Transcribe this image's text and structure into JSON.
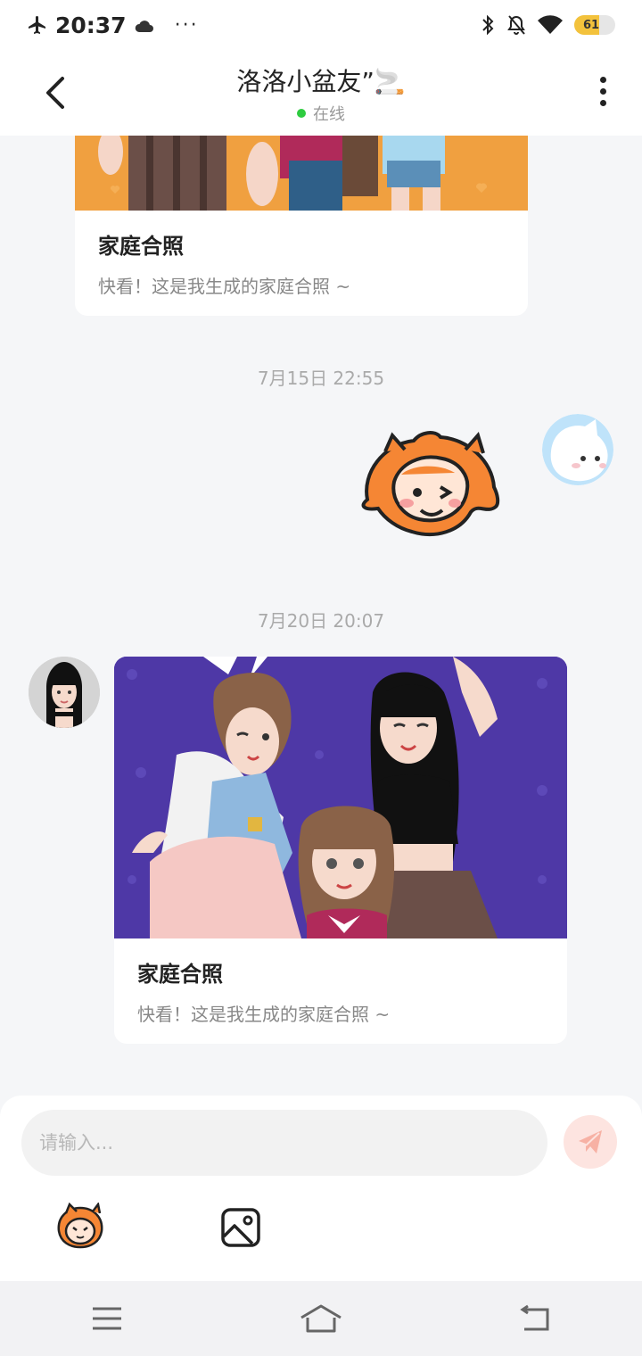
{
  "status_bar": {
    "time": "20:37",
    "more": "···",
    "battery_percent": 61
  },
  "header": {
    "title": "洛洛小盆友”🚬",
    "presence": "在线",
    "presence_color": "#2ecc40"
  },
  "messages": [
    {
      "type": "card",
      "sender": "contact",
      "title": "家庭合照",
      "description": "快看！这是我生成的家庭合照 ~",
      "image_background": "#f0a040"
    },
    {
      "type": "timestamp",
      "text": "7月15日 22:55"
    },
    {
      "type": "sticker",
      "sender": "me",
      "sticker": "winking-orange-mascot"
    },
    {
      "type": "timestamp",
      "text": "7月20日 20:07"
    },
    {
      "type": "card",
      "sender": "contact",
      "title": "家庭合照",
      "description": "快看！这是我生成的家庭合照 ~",
      "image_background": "#4e38a6"
    }
  ],
  "composer": {
    "placeholder": "请输入...",
    "value": "",
    "send_icon": "paper-plane-icon",
    "tools": [
      "sticker-icon",
      "image-icon"
    ]
  },
  "nav_bar": {
    "buttons": [
      "menu-icon",
      "home-icon",
      "back-icon"
    ]
  },
  "colors": {
    "accent": "#f5874a",
    "send_bg": "#fde4e0",
    "chat_bg": "#f5f6f8"
  }
}
